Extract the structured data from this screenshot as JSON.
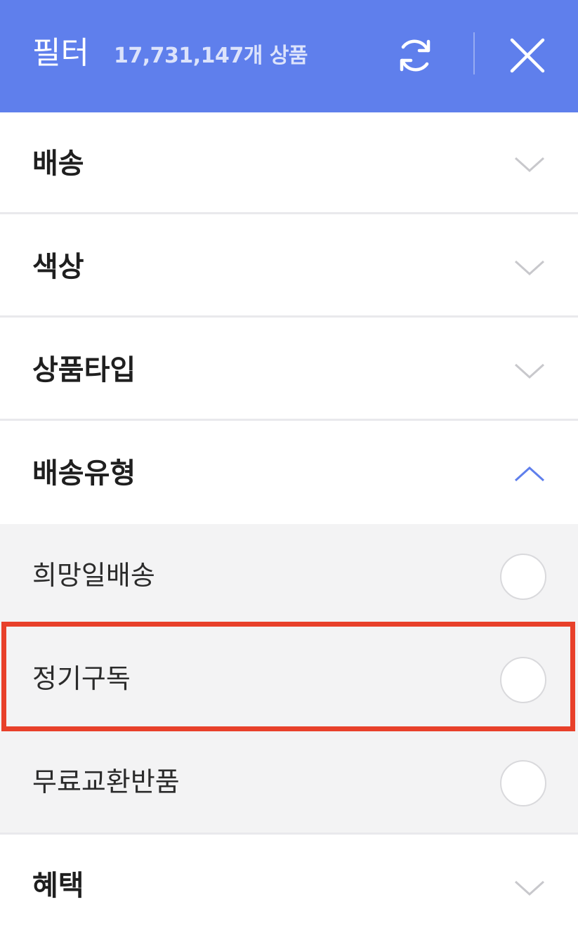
{
  "header": {
    "title": "필터",
    "count": "17,731,147개 상품",
    "refresh_icon": "refresh-icon",
    "close_icon": "close-icon",
    "background": "#5f7fec"
  },
  "sections": [
    {
      "label": "배송",
      "expanded": false
    },
    {
      "label": "색상",
      "expanded": false
    },
    {
      "label": "상품타입",
      "expanded": false
    },
    {
      "label": "배송유형",
      "expanded": true
    },
    {
      "label": "혜택",
      "expanded": false
    }
  ],
  "options": [
    {
      "label": "희망일배송",
      "checked": false
    },
    {
      "label": "정기구독",
      "checked": false,
      "highlighted": true
    },
    {
      "label": "무료교환반품",
      "checked": false
    }
  ],
  "colors": {
    "accent": "#5f7fec",
    "highlight": "#e8402a",
    "chevron_collapsed": "#c8c8cc",
    "chevron_expanded": "#5f7fec"
  }
}
